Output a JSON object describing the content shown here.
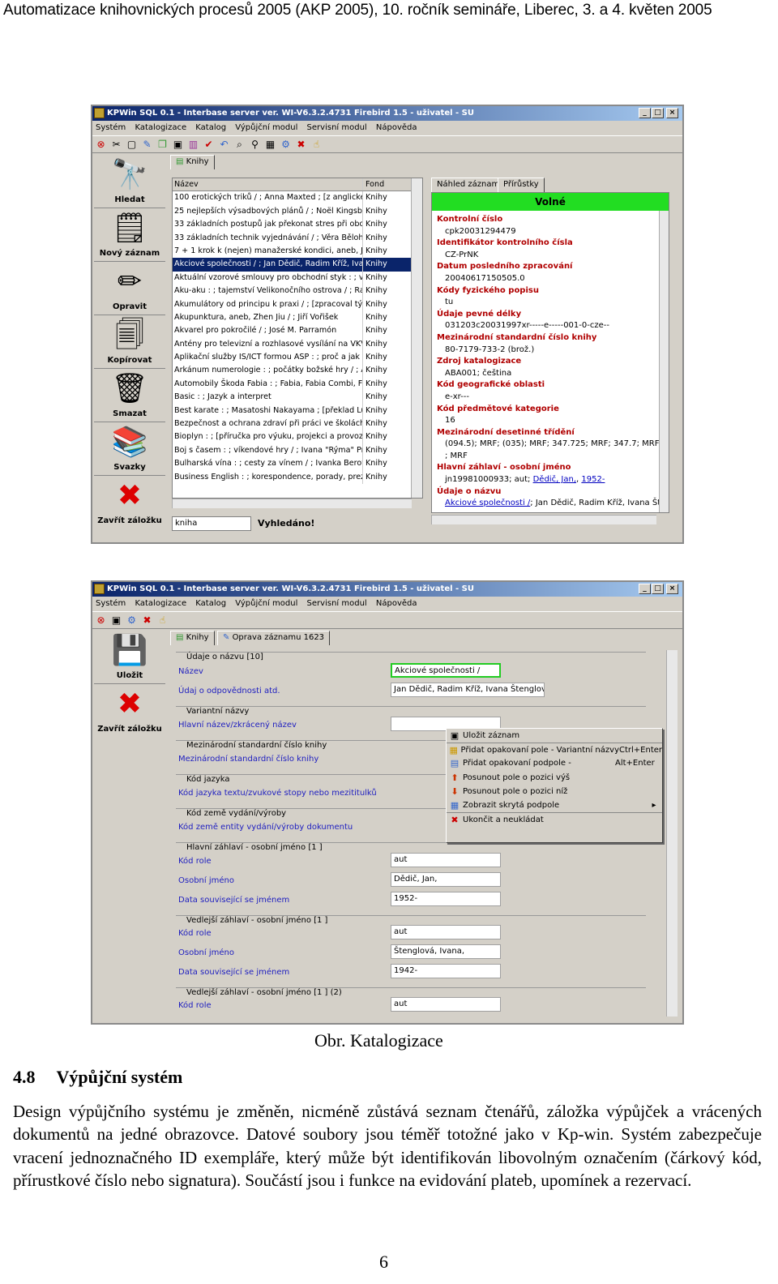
{
  "page_header": "Automatizace knihovnických procesů 2005 (AKP 2005), 10. ročník semináře, Liberec, 3. a 4. květen 2005",
  "win1": {
    "title": "KPWin SQL 0.1 - Interbase server ver. WI-V6.3.2.4731 Firebird 1.5 - uživatel - SU",
    "menu": [
      "Systém",
      "Katalogizace",
      "Katalog",
      "Výpůjční modul",
      "Servisní modul",
      "Nápověda"
    ],
    "left_buttons": [
      "Hledat",
      "Nový záznam",
      "Opravit",
      "Kopírovat",
      "Smazat",
      "Svazky",
      "Zavřít záložku"
    ],
    "tab": "Knihy",
    "col_name": "Název",
    "col_fond": "Fond",
    "rows": [
      {
        "n": "100 erotických triků / ; Anna Maxted ; [z anglického or",
        "f": "Knihy"
      },
      {
        "n": "25 nejlepších výsadbových plánů / ; Noël Kingsbury ; [",
        "f": "Knihy"
      },
      {
        "n": "33 základních postupů jak překonat stres při obchodě",
        "f": "Knihy"
      },
      {
        "n": "33 základních technik vyjednávání / ; Věra Bělohlávk",
        "f": "Knihy"
      },
      {
        "n": "7 + 1 krok k (nejen) manažerské kondici, aneb, Jak zí",
        "f": "Knihy"
      },
      {
        "n": "Akciové společnosti / ; Jan Dědič, Radim Kříž, Ivana",
        "f": "Knihy"
      },
      {
        "n": "Aktuální vzorové smlouvy pro obchodní styk : ; vzory s",
        "f": "Knihy"
      },
      {
        "n": "Aku-aku : ; tajemství Velikonočního ostrova / ; Radek",
        "f": "Knihy"
      },
      {
        "n": "Akumulátory od principu k praxi / ; [zpracoval tým auto",
        "f": "Knihy"
      },
      {
        "n": "Akupunktura, aneb, Zhen Jiu / ; Jiří Vořišek",
        "f": "Knihy"
      },
      {
        "n": "Akvarel pro pokročilé / ; José M. Parramón",
        "f": "Knihy"
      },
      {
        "n": "Antény pro televizní a rozhlasové vysílání na VKV / ; B",
        "f": "Knihy"
      },
      {
        "n": "Aplikační služby IS/ICT formou ASP : ; proč a jak pron",
        "f": "Knihy"
      },
      {
        "n": "Arkánum numerologie : ; počátky božské hry / ; Anna Š",
        "f": "Knihy"
      },
      {
        "n": "Automobily Škoda Fabia : ; Fabia, Fabia Combi, Fabia",
        "f": "Knihy"
      },
      {
        "n": "Basic : ; Jazyk a interpret",
        "f": "Knihy"
      },
      {
        "n": "Best karate : ; Masatoshi Nakayama ; [překlad Ludvík",
        "f": "Knihy"
      },
      {
        "n": "Bezpečnost a ochrana zdraví při práci ve školách a š",
        "f": "Knihy"
      },
      {
        "n": "Bioplyn : ; [příručka pro výuku, projekci a provoz bioplj",
        "f": "Knihy"
      },
      {
        "n": "Boj s časem : ; víkendové hry / ; Ivana \"Rýma\" Průšov",
        "f": "Knihy"
      },
      {
        "n": "Bulharská vína : ; cesty za vínem / ; Ivanka Berovská,",
        "f": "Knihy"
      },
      {
        "n": "Business English : ; korespondence, porady, prezentac",
        "f": "Knihy"
      }
    ],
    "search_value": "kniha",
    "search_status": "Vyhledáno!",
    "rtab1": "Náhled záznamu",
    "rtab2": "Přírůstky",
    "status": "Volné",
    "detail": [
      {
        "h": "Kontrolní číslo",
        "v": "cpk20031294479"
      },
      {
        "h": "Identifikátor kontrolního čísla",
        "v": "CZ-PrNK"
      },
      {
        "h": "Datum posledního zpracování",
        "v": "20040617150505.0"
      },
      {
        "h": "Kódy fyzického popisu",
        "v": "tu"
      },
      {
        "h": "Údaje pevné délky",
        "v": "031203c20031997xr-----e-----001-0-cze--"
      },
      {
        "h": "Mezinárodní standardní číslo knihy",
        "v": "80-7179-733-2 (brož.)"
      },
      {
        "h": "Zdroj katalogizace",
        "v": "ABA001; čeština"
      },
      {
        "h": "Kód geografické oblasti",
        "v": "e-xr---"
      },
      {
        "h": "Kód předmětové kategorie",
        "v": "16"
      },
      {
        "h": "Mezinárodní desetinné třídění",
        "v": "(094.5); MRF; (035); MRF; 347.725; MRF; 347.7; MRF; (437.3"
      },
      {
        "h": "",
        "v": "; MRF"
      },
      {
        "h": "Hlavní záhlaví - osobní jméno",
        "v": "jn19981000933; aut;"
      },
      {
        "h": "Údaje o názvu",
        "v": ""
      }
    ],
    "link1": "Dědič, Jan,",
    "link2": "1952-",
    "last_link": "Akciové společnosti /",
    "last_rest": "; Jan Dědič, Radim Kříž, Ivana Štenglo"
  },
  "win2": {
    "title": "KPWin SQL 0.1 - Interbase server ver. WI-V6.3.2.4731 Firebird 1.5 - uživatel - SU",
    "menu": [
      "Systém",
      "Katalogizace",
      "Katalog",
      "Výpůjční modul",
      "Servisní modul",
      "Nápověda"
    ],
    "left_buttons": [
      "Uložit",
      "Zavřít záložku"
    ],
    "tab1": "Knihy",
    "tab2": "Oprava záznamu 1623",
    "groups": [
      "Údaje o názvu    [10]",
      "Variantní názvy",
      "Mezinárodní standardní číslo knihy",
      "Kód jazyka",
      "Kód země vydání/výroby",
      "Hlavní záhlaví - osobní jméno    [1 ]",
      "Vedlejší záhlaví - osobní jméno    [1 ]",
      "Vedlejší záhlaví - osobní jméno    [1 ] (2)"
    ],
    "fields": [
      "Název",
      "Údaj o odpovědnosti atd.",
      "Hlavní název/zkrácený název",
      "Mezinárodní standardní číslo knihy",
      "Kód jazyka textu/zvukové stopy nebo mezititulků",
      "Kód země entity vydání/výroby dokumentu",
      "Kód role",
      "Osobní jméno",
      "Data související se jménem",
      "Kód role",
      "Osobní jméno",
      "Data související se jménem",
      "Kód role"
    ],
    "values": [
      "Akciové společnosti /",
      "Jan Dědič, Radim Kříž, Ivana Štenglová",
      "aut",
      "Dědič, Jan,",
      "1952-",
      "aut",
      "Štenglová, Ivana,",
      "1942-",
      "aut"
    ],
    "context_menu": [
      {
        "label": "Uložit záznam",
        "shortcut": ""
      },
      {
        "label": "Přidat opakovaní pole - Variantní názvy",
        "shortcut": "Ctrl+Enter"
      },
      {
        "label": "Přidat opakovaní podpole -",
        "shortcut": "Alt+Enter"
      },
      {
        "label": "Posunout pole o pozici výš",
        "shortcut": ""
      },
      {
        "label": "Posunout pole o pozici níž",
        "shortcut": ""
      },
      {
        "label": "Zobrazit skrytá podpole",
        "shortcut": ""
      },
      {
        "label": "Ukončit a neukládat",
        "shortcut": ""
      }
    ]
  },
  "caption": "Obr. Katalogizace",
  "section": {
    "num": "4.8",
    "title": "Výpůjční systém"
  },
  "paragraph": "Design výpůjčního systému je změněn, nicméně zůstává seznam čtenářů, záložka výpůjček a vrácených dokumentů na jedné obrazovce. Datové soubory jsou téměř totožné jako v Kp-win. Systém zabezpečuje vracení jednoznačného ID exempláře, který může být identifikován libovolným označením (čárkový kód, přírustkové číslo nebo signatura). Součástí jsou i funkce na evidování plateb, upomínek a rezervací.",
  "page_number": "6"
}
